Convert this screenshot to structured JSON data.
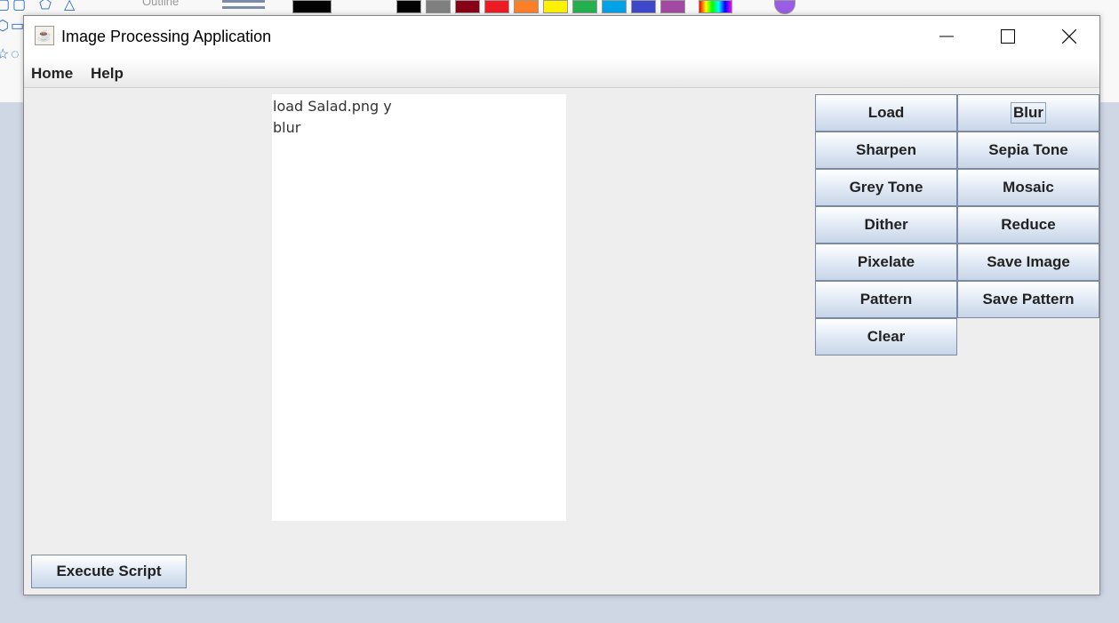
{
  "background_app": {
    "outline_label": "Outline",
    "swatches": [
      "#000000",
      "#7f7f7f",
      "#880015",
      "#ed1c24",
      "#ff7f27",
      "#fff200",
      "#22b14c",
      "#00a2e8",
      "#3f48cc",
      "#a349a4"
    ]
  },
  "window": {
    "title": "Image Processing Application",
    "icon": "java-icon",
    "controls": {
      "minimize_icon": "minimize-icon",
      "maximize_icon": "maximize-icon",
      "close_icon": "close-icon"
    }
  },
  "menu": {
    "home": "Home",
    "help": "Help"
  },
  "script": {
    "lines": [
      "load Salad.png y",
      "blur"
    ]
  },
  "buttons": {
    "load": "Load",
    "blur": "Blur",
    "sharpen": "Sharpen",
    "sepia": "Sepia Tone",
    "grey": "Grey Tone",
    "mosaic": "Mosaic",
    "dither": "Dither",
    "reduce": "Reduce",
    "pixelate": "Pixelate",
    "save_image": "Save Image",
    "pattern": "Pattern",
    "save_pattern": "Save Pattern",
    "clear": "Clear",
    "execute": "Execute Script"
  }
}
